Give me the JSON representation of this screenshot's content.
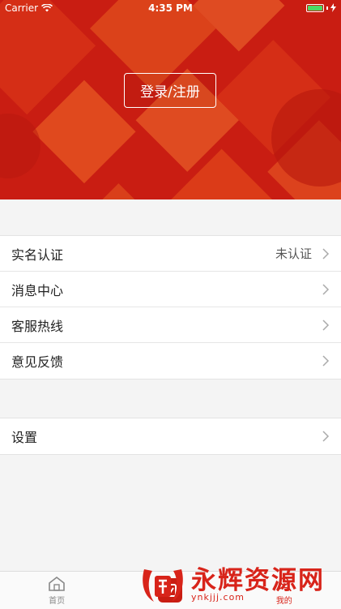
{
  "status_bar": {
    "carrier": "Carrier",
    "time": "4:35 PM"
  },
  "header": {
    "login_label": "登录/注册"
  },
  "menu_group_1": [
    {
      "label": "实名认证",
      "value": "未认证"
    },
    {
      "label": "消息中心"
    },
    {
      "label": "客服热线"
    },
    {
      "label": "意见反馈"
    }
  ],
  "menu_group_2": [
    {
      "label": "设置"
    }
  ],
  "tabbar": {
    "tabs": [
      {
        "label": "首页",
        "icon": "home-icon"
      },
      {
        "label": "",
        "icon": "center-brand-icon"
      },
      {
        "label": "我的",
        "icon": "user-icon",
        "active": true
      }
    ]
  },
  "watermark": {
    "title": "永辉资源网",
    "url": "ynkjjj.com"
  },
  "colors": {
    "accent": "#d8241a",
    "header_bg": "#c91d12",
    "battery": "#4cd964"
  }
}
